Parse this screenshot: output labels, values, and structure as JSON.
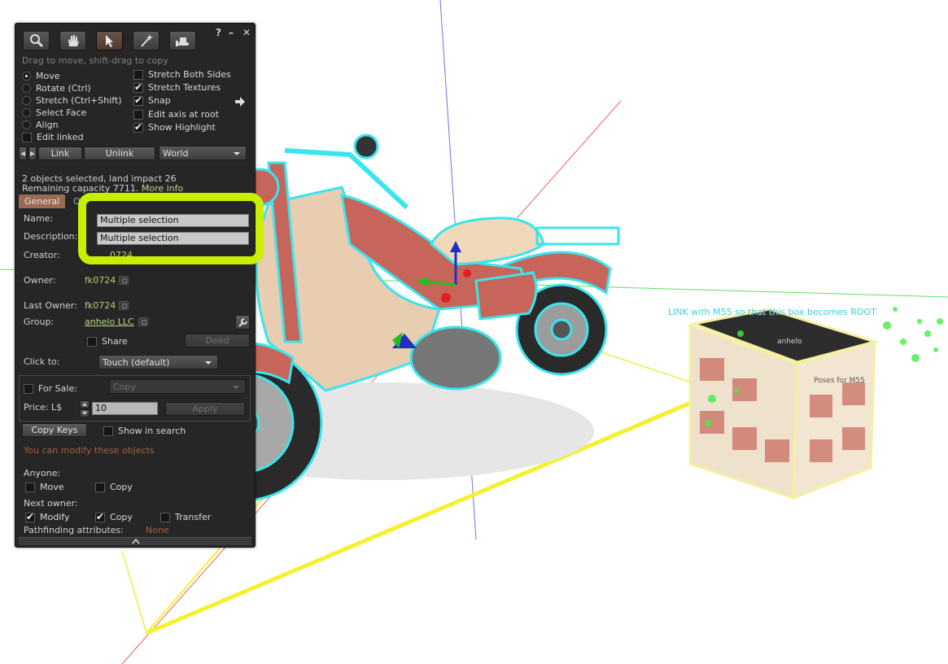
{
  "toolbar": {
    "tools": [
      "magnifier-icon",
      "hand-icon",
      "pointer-icon",
      "wand-icon",
      "bulldozer-icon"
    ],
    "title_help": "?",
    "title_minimize": "–",
    "title_close": "✕"
  },
  "hint": "Drag to move, shift-drag to copy",
  "modes": [
    {
      "label": "Move",
      "selected": true
    },
    {
      "label": "Rotate (Ctrl)",
      "selected": false
    },
    {
      "label": "Stretch (Ctrl+Shift)",
      "selected": false
    },
    {
      "label": "Select Face",
      "selected": false
    },
    {
      "label": "Align",
      "selected": false
    }
  ],
  "options": [
    {
      "label": "Stretch Both Sides",
      "checked": false
    },
    {
      "label": "Stretch Textures",
      "checked": true
    },
    {
      "label": "Snap",
      "checked": true
    },
    {
      "label": "Edit axis at root",
      "checked": false
    },
    {
      "label": "Show Highlight",
      "checked": true
    }
  ],
  "edit_linked": {
    "label": "Edit linked",
    "checked": false
  },
  "link_bar": {
    "link": "Link",
    "unlink": "Unlink",
    "ruler": "World"
  },
  "selection": {
    "summary": "2 objects selected, land impact 26",
    "capacity": "Remaining capacity 7711.",
    "more_info": "More info"
  },
  "tabs": {
    "general": "General",
    "second": "Ob"
  },
  "general": {
    "name_label": "Name:",
    "name_value": "Multiple selection",
    "description_label": "Description:",
    "description_value": "Multiple selection",
    "creator_label": "Creator:",
    "creator_value": "0724",
    "owner_label": "Owner:",
    "owner_value": "fk0724",
    "last_owner_label": "Last Owner:",
    "last_owner_value": "fk0724",
    "group_label": "Group:",
    "group_value": "anhelo LLC",
    "share_label": "Share",
    "deed_label": "Deed",
    "click_label": "Click to:",
    "click_value": "Touch  (default)",
    "for_sale_label": "For Sale:",
    "sale_type": "Copy",
    "price_label": "Price: L$",
    "price_value": "10",
    "apply_label": "Apply",
    "copy_keys_label": "Copy Keys",
    "show_search_label": "Show in search",
    "modify_note": "You can modify these objects",
    "anyone_label": "Anyone:",
    "anyone_move": "Move",
    "anyone_copy": "Copy",
    "next_owner_label": "Next owner:",
    "next_modify": "Modify",
    "next_copy": "Copy",
    "next_transfer": "Transfer",
    "pathfinding_label": "Pathfinding attributes:",
    "pathfinding_value": "None"
  },
  "scene": {
    "cube_label": "LINK with M55 so that this box becomes ROOT",
    "cube_title": "Poses for M55",
    "cube_brand": "anhelo"
  },
  "colors": {
    "highlight": "#c7f000",
    "outline": "#39e5ee",
    "bike_body": "#c8655a"
  }
}
